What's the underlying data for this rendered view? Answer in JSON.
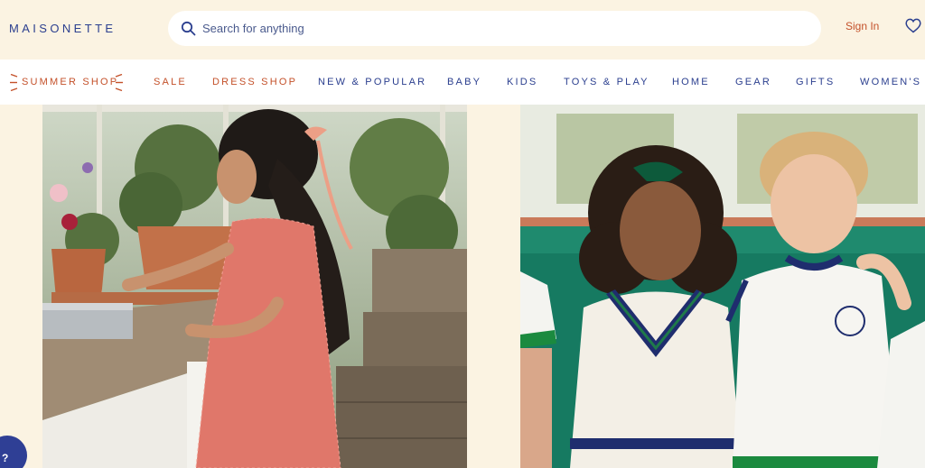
{
  "header": {
    "logo": "MAISONETTE",
    "search_placeholder": "Search for anything",
    "signin_label": "Sign In"
  },
  "nav": {
    "items": [
      {
        "label": "SUMMER SHOP"
      },
      {
        "label": "SALE"
      },
      {
        "label": "DRESS SHOP"
      },
      {
        "label": "NEW & POPULAR"
      },
      {
        "label": "BABY"
      },
      {
        "label": "KIDS"
      },
      {
        "label": "TOYS & PLAY"
      },
      {
        "label": "HOME"
      },
      {
        "label": "GEAR"
      },
      {
        "label": "GIFTS"
      },
      {
        "label": "WOMEN'S"
      }
    ]
  },
  "help": {
    "label": "?"
  },
  "colors": {
    "background": "#fbf3e2",
    "brand_blue": "#2b3f8f",
    "accent_orange": "#c4512a"
  },
  "icons": {
    "search": "search-icon",
    "wishlist": "heart-icon",
    "summer": "sun-rays-icon"
  }
}
